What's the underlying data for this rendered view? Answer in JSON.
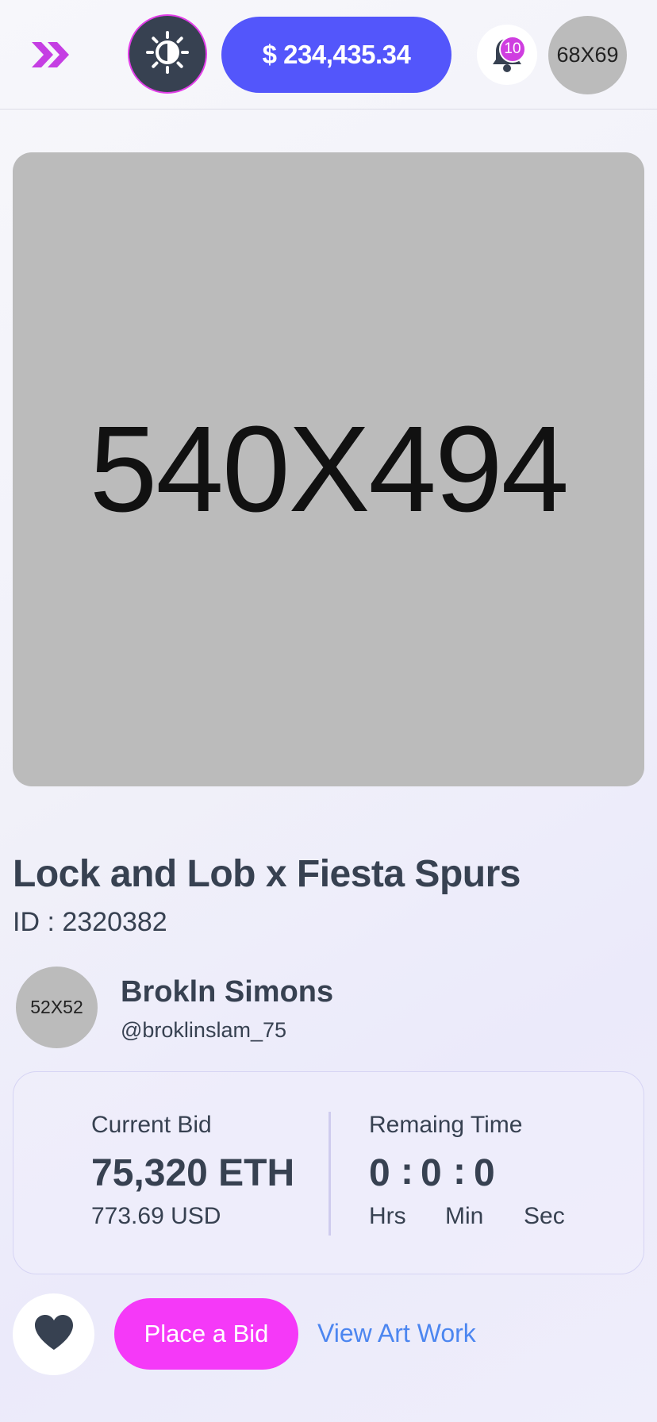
{
  "header": {
    "menu_icon": "double-chevron-right-icon",
    "theme_icon": "sun-contrast-icon",
    "balance": "$ 234,435.34",
    "notification_icon": "bell-icon",
    "notification_count": "10",
    "avatar_placeholder": "68X69"
  },
  "artwork": {
    "placeholder": "540X494"
  },
  "item": {
    "title": "Lock and Lob x Fiesta Spurs",
    "id_text": "ID : 2320382"
  },
  "owner": {
    "avatar_placeholder": "52X52",
    "name": "Brokln Simons",
    "handle": "@broklinslam_75"
  },
  "bid": {
    "current_label": "Current Bid",
    "current_value": "75,320 ETH",
    "current_usd": "773.69 USD",
    "time_label": "Remaing Time",
    "hours": "0",
    "minutes": "0",
    "seconds": "0",
    "separator": ":",
    "hours_label": "Hrs",
    "minutes_label": "Min",
    "seconds_label": "Sec"
  },
  "actions": {
    "favorite_icon": "heart-icon",
    "place_bid_label": "Place a Bid",
    "view_artwork_label": "View Art Work"
  },
  "colors": {
    "accent": "#5356fb",
    "pink": "#f539f8",
    "link": "#4c86f0",
    "text": "#374151"
  }
}
